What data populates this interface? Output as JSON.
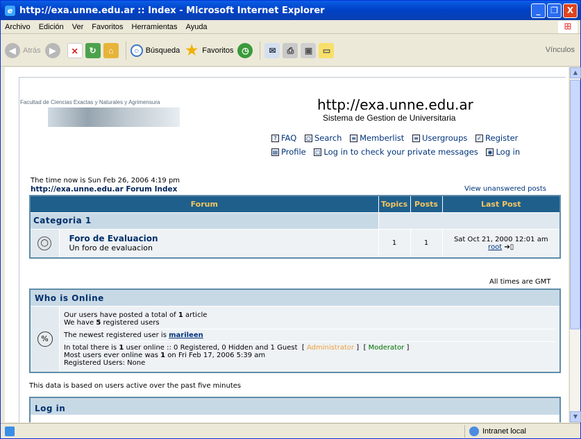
{
  "window": {
    "title": "http://exa.unne.edu.ar :: Index - Microsoft Internet Explorer",
    "minimize": "_",
    "maximize": "❐",
    "close": "X"
  },
  "menubar": {
    "items": [
      "Archivo",
      "Edición",
      "Ver",
      "Favoritos",
      "Herramientas",
      "Ayuda"
    ]
  },
  "toolbar": {
    "back_label": "Atrás",
    "search_label": "Búsqueda",
    "favorites_label": "Favoritos",
    "links_label": "Vínculos"
  },
  "page": {
    "logo_caption": "Facultad de Ciencias Exactas y Naturales y Agrimensura",
    "site_title": "http://exa.unne.edu.ar",
    "site_subtitle": "Sistema de Gestion de Universitaria",
    "nav": {
      "faq": "FAQ",
      "search": "Search",
      "memberlist": "Memberlist",
      "usergroups": "Usergroups",
      "register": "Register",
      "profile": "Profile",
      "messages": "Log in to check your private messages",
      "login": "Log in"
    },
    "time_now": "The time now is Sun Feb 26, 2006 4:19 pm",
    "forum_index": "http://exa.unne.edu.ar Forum Index",
    "view_unanswered": "View unanswered posts",
    "table": {
      "headers": {
        "forum": "Forum",
        "topics": "Topics",
        "posts": "Posts",
        "last_post": "Last Post"
      },
      "category": "Categoria 1",
      "forum": {
        "name": "Foro de Evaluacion",
        "description": "Un foro de evaluacion",
        "topics": "1",
        "posts": "1",
        "last_post_date": "Sat Oct 21, 2000 12:01 am",
        "last_post_user": "root",
        "last_post_arrow": "➔▯"
      }
    },
    "all_times": "All times are GMT",
    "who": {
      "title": "Who is Online",
      "line1_prefix": "Our users have posted a total of ",
      "line1_count": "1",
      "line1_suffix": " article",
      "line2_prefix": "We have ",
      "line2_count": "5",
      "line2_suffix": " registered users",
      "newest_prefix": "The newest registered user is ",
      "newest_user": "marileen",
      "online_prefix": "In total there is ",
      "online_count": "1",
      "online_suffix": " user online :: 0 Registered, 0 Hidden and 1 Guest",
      "admin_label": "Administrator",
      "mod_label": "Moderator",
      "most_prefix": "Most users ever online was ",
      "most_count": "1",
      "most_suffix": " on Fri Feb 17, 2006 5:39 am",
      "registered_users": "Registered Users: None"
    },
    "data_based": "This data is based on users active over the past five minutes",
    "login_title": "Log in"
  },
  "statusbar": {
    "zone": "Intranet local"
  }
}
